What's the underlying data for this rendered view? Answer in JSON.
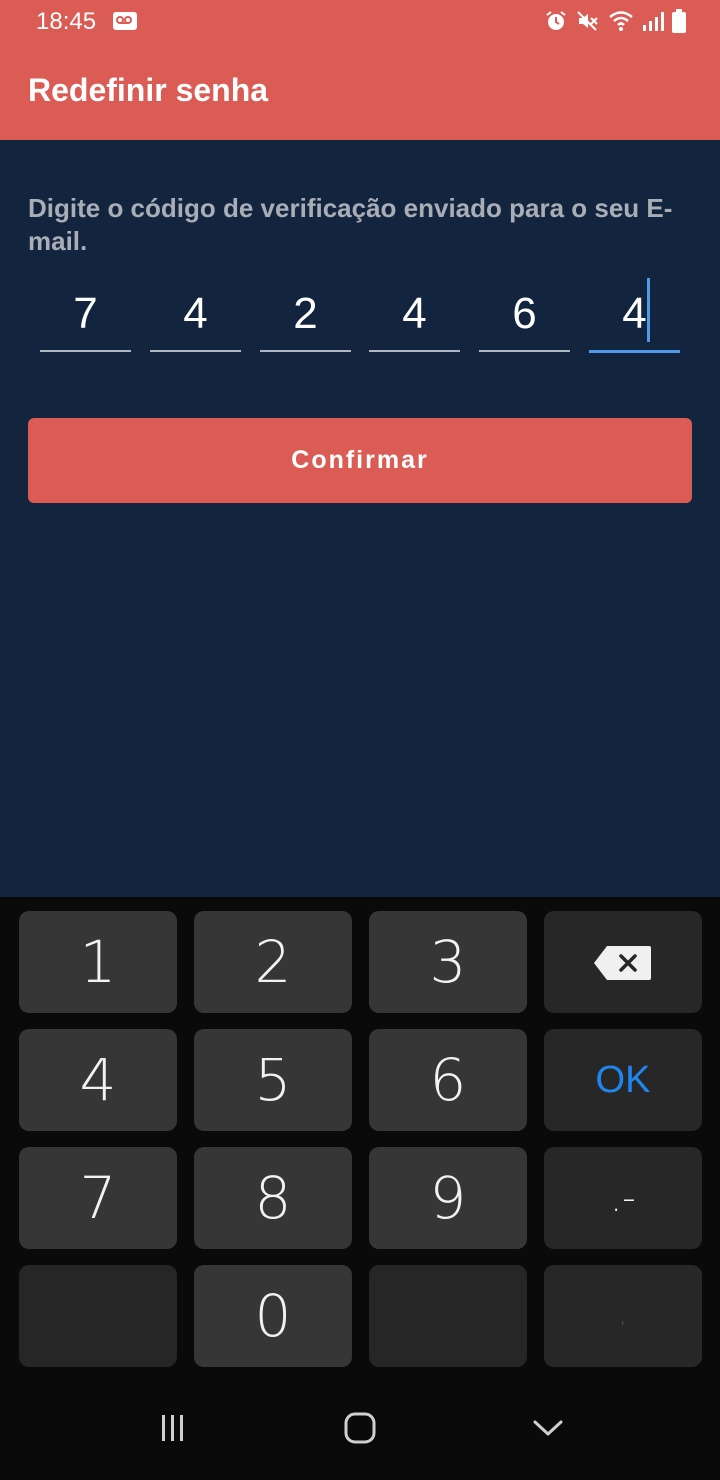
{
  "status_bar": {
    "time": "18:45",
    "icons": [
      "voicemail-icon",
      "alarm-icon",
      "mute-icon",
      "wifi-icon",
      "signal-icon",
      "battery-icon"
    ]
  },
  "appbar": {
    "title": "Redefinir senha",
    "color": "#db5c55"
  },
  "content": {
    "instruction": "Digite o código de verificação enviado para o seu E-mail.",
    "code": [
      "7",
      "4",
      "2",
      "4",
      "6",
      "4"
    ],
    "confirm_label": "Confirmar",
    "background": "#12243e"
  },
  "keyboard": {
    "keys": [
      "1",
      "2",
      "3",
      "4",
      "5",
      "6",
      "OK",
      "7",
      "8",
      "9",
      ".-",
      "0",
      ","
    ],
    "backspace_icon": "backspace-icon"
  },
  "navbar": {
    "icons": [
      "recent-apps-icon",
      "home-icon",
      "back-icon"
    ]
  }
}
